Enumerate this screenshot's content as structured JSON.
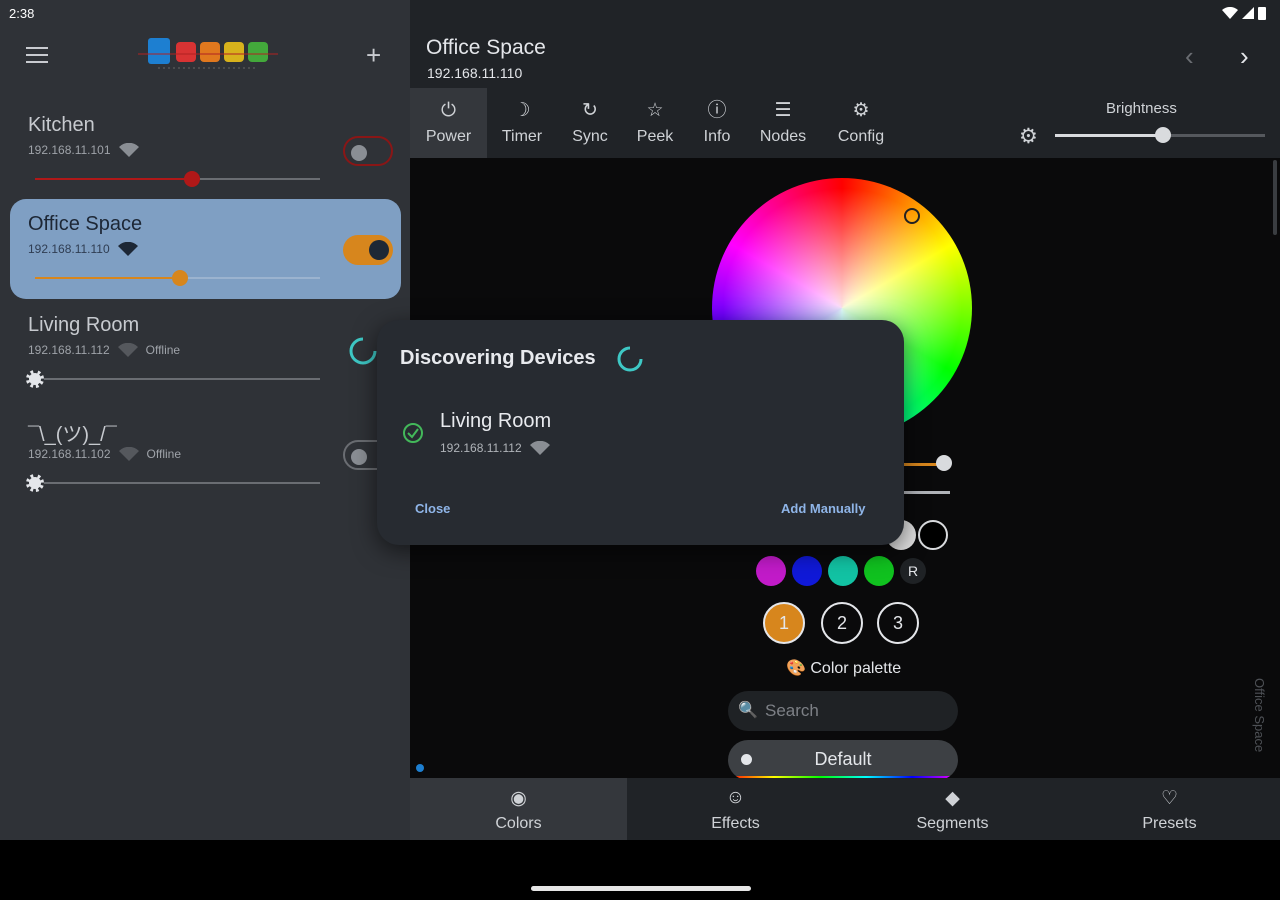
{
  "status_bar": {
    "time": "2:38"
  },
  "drawer": {
    "logo_alt": "WLED",
    "devices": [
      {
        "name": "Kitchen",
        "ip": "192.168.11.101",
        "status": "",
        "brightness": 0.55,
        "on": false,
        "accent": "#b01818"
      },
      {
        "name": "Office Space",
        "ip": "192.168.11.110",
        "status": "",
        "brightness": 0.51,
        "on": true,
        "accent": "#d7861d"
      },
      {
        "name": "Living Room",
        "ip": "192.168.11.112",
        "status": "Offline",
        "brightness": 0.0,
        "on": false,
        "accent": "#9fa3a9"
      },
      {
        "name": "¯\\_(ツ)_/¯",
        "ip": "192.168.11.102",
        "status": "Offline",
        "brightness": 0.0,
        "on": false,
        "accent": "#9fa3a9"
      }
    ]
  },
  "appbar": {
    "title": "Office Space",
    "subtitle": "192.168.11.110"
  },
  "tabs": [
    {
      "label": "Power",
      "icon": "power-icon",
      "active": true
    },
    {
      "label": "Timer",
      "icon": "moon-icon",
      "active": false
    },
    {
      "label": "Sync",
      "icon": "sync-icon",
      "active": false
    },
    {
      "label": "Peek",
      "icon": "star-icon",
      "active": false
    },
    {
      "label": "Info",
      "icon": "info-icon",
      "active": false
    },
    {
      "label": "Nodes",
      "icon": "list-icon",
      "active": false
    },
    {
      "label": "Config",
      "icon": "gear-icon",
      "active": false
    }
  ],
  "brightness": {
    "label": "Brightness",
    "value": 0.52
  },
  "colors": {
    "accent": "#d7861d",
    "swatches_row2": [
      "#c21bc9",
      "#1019d8",
      "#12c3a4",
      "#10c21f"
    ],
    "random_label": "R",
    "slots": [
      "1",
      "2",
      "3"
    ],
    "palette_label": "Color palette",
    "search_placeholder": "Search",
    "palette_selected": "Default",
    "side_label": "Office Space"
  },
  "bottom_nav": [
    {
      "label": "Colors",
      "icon": "palette-icon",
      "active": true
    },
    {
      "label": "Effects",
      "icon": "smiley-icon",
      "active": false
    },
    {
      "label": "Segments",
      "icon": "layers-icon",
      "active": false
    },
    {
      "label": "Presets",
      "icon": "heart-icon",
      "active": false
    }
  ],
  "dialog": {
    "title": "Discovering Devices",
    "found_name": "Living Room",
    "found_ip": "192.168.11.112",
    "close_label": "Close",
    "add_manually_label": "Add Manually"
  }
}
